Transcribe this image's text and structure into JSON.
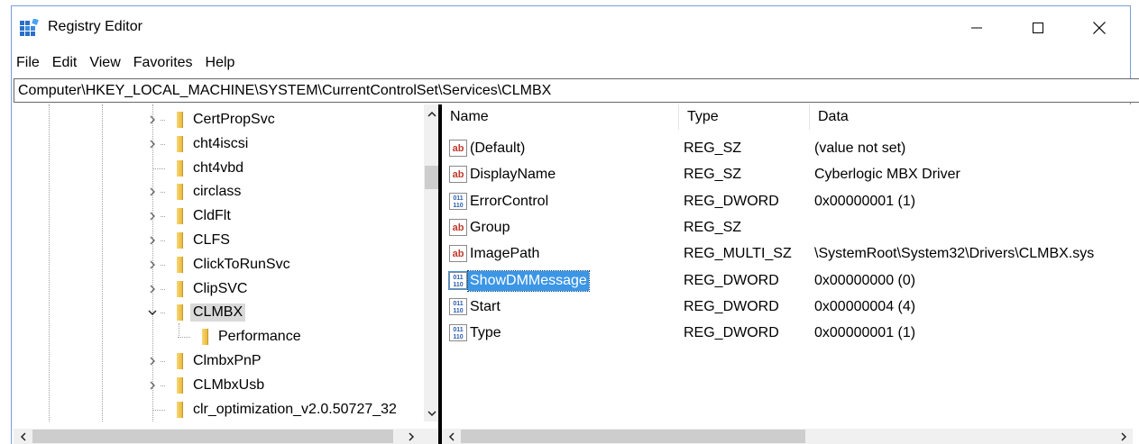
{
  "window": {
    "title": "Registry Editor",
    "controls": {
      "minimize": "—",
      "maximize": "☐",
      "close": "✕"
    }
  },
  "menu": [
    "File",
    "Edit",
    "View",
    "Favorites",
    "Help"
  ],
  "address": "Computer\\HKEY_LOCAL_MACHINE\\SYSTEM\\CurrentControlSet\\Services\\CLMBX",
  "tree": {
    "items": [
      {
        "label": "CertPropSvc",
        "expander": "collapsed",
        "depth": 0,
        "selected": false
      },
      {
        "label": "cht4iscsi",
        "expander": "collapsed",
        "depth": 0,
        "selected": false
      },
      {
        "label": "cht4vbd",
        "expander": "none",
        "depth": 0,
        "selected": false
      },
      {
        "label": "circlass",
        "expander": "collapsed",
        "depth": 0,
        "selected": false
      },
      {
        "label": "CldFlt",
        "expander": "collapsed",
        "depth": 0,
        "selected": false
      },
      {
        "label": "CLFS",
        "expander": "collapsed",
        "depth": 0,
        "selected": false
      },
      {
        "label": "ClickToRunSvc",
        "expander": "collapsed",
        "depth": 0,
        "selected": false
      },
      {
        "label": "ClipSVC",
        "expander": "collapsed",
        "depth": 0,
        "selected": false
      },
      {
        "label": "CLMBX",
        "expander": "expanded",
        "depth": 0,
        "selected": true
      },
      {
        "label": "Performance",
        "expander": "none",
        "depth": 1,
        "selected": false
      },
      {
        "label": "ClmbxPnP",
        "expander": "collapsed",
        "depth": 0,
        "selected": false
      },
      {
        "label": "CLMbxUsb",
        "expander": "collapsed",
        "depth": 0,
        "selected": false
      },
      {
        "label": "clr_optimization_v2.0.50727_32",
        "expander": "none",
        "depth": 0,
        "selected": false
      }
    ]
  },
  "list": {
    "columns": {
      "name": "Name",
      "type": "Type",
      "data": "Data"
    },
    "rows": [
      {
        "name": "(Default)",
        "type": "REG_SZ",
        "data": "(value not set)",
        "icon": "string-value-icon",
        "selected": false
      },
      {
        "name": "DisplayName",
        "type": "REG_SZ",
        "data": "Cyberlogic MBX Driver",
        "icon": "string-value-icon",
        "selected": false
      },
      {
        "name": "ErrorControl",
        "type": "REG_DWORD",
        "data": "0x00000001 (1)",
        "icon": "binary-value-icon",
        "selected": false
      },
      {
        "name": "Group",
        "type": "REG_SZ",
        "data": "",
        "icon": "string-value-icon",
        "selected": false
      },
      {
        "name": "ImagePath",
        "type": "REG_MULTI_SZ",
        "data": "\\SystemRoot\\System32\\Drivers\\CLMBX.sys",
        "icon": "string-value-icon",
        "selected": false
      },
      {
        "name": "ShowDMMessage",
        "type": "REG_DWORD",
        "data": "0x00000000 (0)",
        "icon": "binary-value-icon",
        "selected": true
      },
      {
        "name": "Start",
        "type": "REG_DWORD",
        "data": "0x00000004 (4)",
        "icon": "binary-value-icon",
        "selected": false
      },
      {
        "name": "Type",
        "type": "REG_DWORD",
        "data": "0x00000001 (1)",
        "icon": "binary-value-icon",
        "selected": false
      }
    ]
  },
  "colors": {
    "selection": "#3c96e6",
    "tree_selection": "#d9d9d9",
    "window_border": "#7a9fd6",
    "folder": "#e9b83a"
  }
}
